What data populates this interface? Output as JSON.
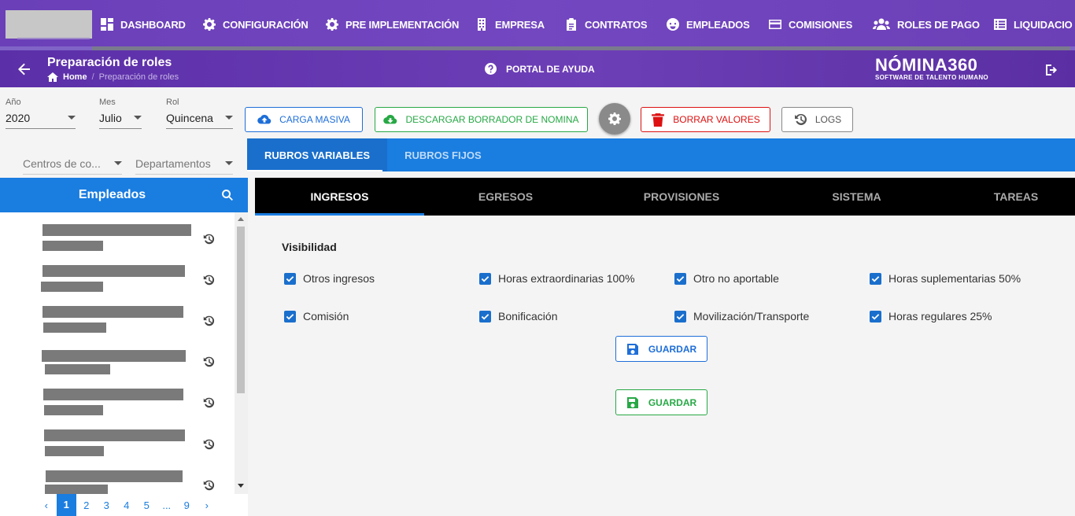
{
  "nav": {
    "items": [
      {
        "label": "DASHBOARD",
        "icon": "dashboard-icon"
      },
      {
        "label": "CONFIGURACIÓN",
        "icon": "gear-icon"
      },
      {
        "label": "PRE IMPLEMENTACIÓN",
        "icon": "gear-icon"
      },
      {
        "label": "EMPRESA",
        "icon": "building-icon"
      },
      {
        "label": "CONTRATOS",
        "icon": "clipboard-icon"
      },
      {
        "label": "EMPLEADOS",
        "icon": "face-icon"
      },
      {
        "label": "COMISIONES",
        "icon": "card-icon"
      },
      {
        "label": "ROLES DE PAGO",
        "icon": "users-icon"
      },
      {
        "label": "LIQUIDACIO",
        "icon": "list-icon"
      }
    ]
  },
  "header": {
    "title": "Preparación de roles",
    "breadcrumb_home": "Home",
    "breadcrumb_current": "Preparación de roles",
    "help_label": "PORTAL DE AYUDA",
    "brand_name": "NÓMINA360",
    "brand_tagline": "SOFTWARE DE TALENTO HUMANO"
  },
  "filters": {
    "year_label": "Año",
    "year_value": "2020",
    "month_label": "Mes",
    "month_value": "Julio",
    "rol_label": "Rol",
    "rol_value": "Quincena",
    "centros_placeholder": "Centros de co...",
    "departamentos_placeholder": "Departamentos"
  },
  "actions": {
    "carga_masiva": "CARGA MASIVA",
    "descargar": "DESCARGAR BORRADOR DE NOMINA",
    "borrar": "BORRAR VALORES",
    "logs": "LOGS"
  },
  "rubros_tabs": [
    "RUBROS VARIABLES",
    "RUBROS FIJOS"
  ],
  "employees": {
    "title": "Empleados",
    "pages": [
      "1",
      "2",
      "3",
      "4",
      "5",
      "...",
      "9"
    ]
  },
  "main_tabs": [
    "INGRESOS",
    "EGRESOS",
    "PROVISIONES",
    "SISTEMA",
    "TAREAS"
  ],
  "visibility": {
    "title": "Visibilidad",
    "options": [
      "Otros ingresos",
      "Horas extraordinarias 100%",
      "Otro no aportable",
      "Horas suplementarias 50%",
      "Comisión",
      "Bonificación",
      "Movilización/Transporte",
      "Horas regulares 25%"
    ],
    "save_label_1": "GUARDAR",
    "save_label_2": "GUARDAR"
  },
  "colors": {
    "nav_purple": "#6a3fb8",
    "primary_blue": "#1a7de0",
    "success_green": "#27a845",
    "danger_red": "#dd1111"
  }
}
